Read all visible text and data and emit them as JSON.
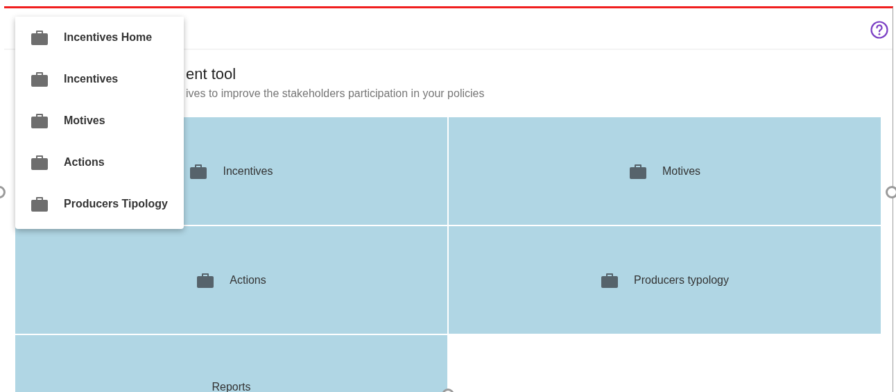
{
  "heading": {
    "title": "ent tool",
    "subtitle": "ives to improve the stakeholders participation in your policies"
  },
  "tiles": [
    {
      "label": "Incentives",
      "kind": "icon"
    },
    {
      "label": "Motives",
      "kind": "icon"
    },
    {
      "label": "Actions",
      "kind": "icon"
    },
    {
      "label": "Producers typology",
      "kind": "icon"
    },
    {
      "label": "Reports",
      "kind": "text"
    }
  ],
  "menu": {
    "items": [
      {
        "label": "Incentives Home"
      },
      {
        "label": "Incentives"
      },
      {
        "label": "Motives"
      },
      {
        "label": "Actions"
      },
      {
        "label": "Producers Tipology"
      }
    ]
  }
}
